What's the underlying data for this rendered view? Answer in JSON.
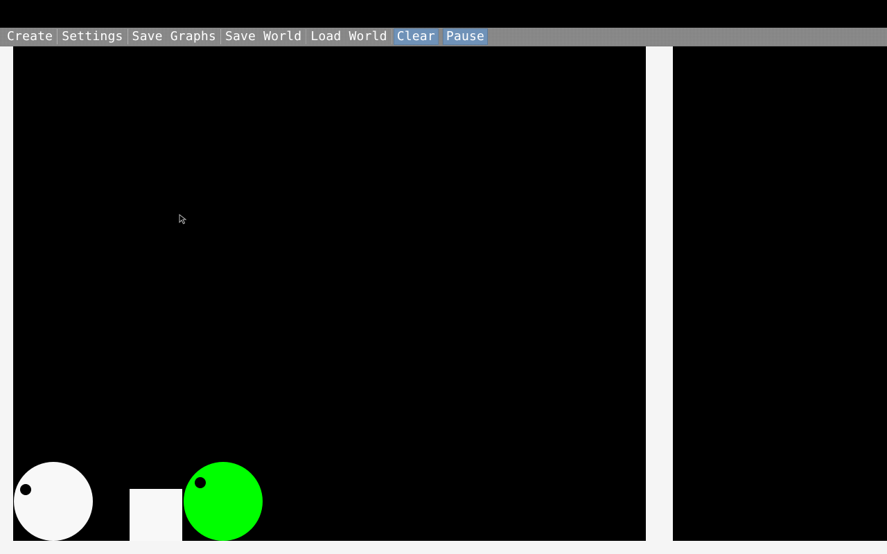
{
  "menu": {
    "items": [
      {
        "label": "Create"
      },
      {
        "label": "Settings"
      },
      {
        "label": "Save Graphs"
      },
      {
        "label": "Save World"
      },
      {
        "label": "Load World"
      },
      {
        "label": "Clear"
      },
      {
        "label": "Pause"
      }
    ]
  },
  "colors": {
    "menubar": "#8a8a8a",
    "highlight": "#6f92b8",
    "sim_background": "#000000",
    "agent_white": "#f8f8f8",
    "agent_green": "#00ff00",
    "food_block": "#f8f8f8",
    "eye": "#000000"
  },
  "icons": {
    "cursor": "mouse-pointer-icon"
  }
}
